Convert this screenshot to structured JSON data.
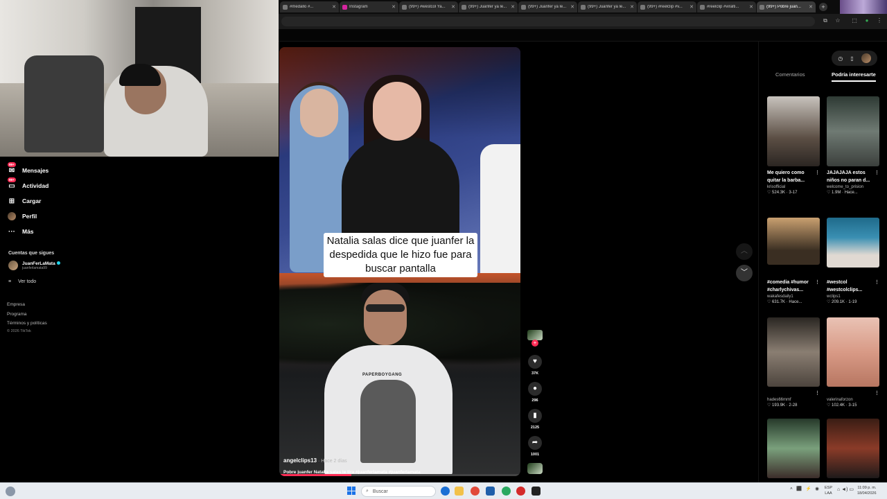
{
  "browser": {
    "tabs": [
      {
        "label": "#medallo #..."
      },
      {
        "label": "Instagram"
      },
      {
        "label": "(99+) #westcol Ya..."
      },
      {
        "label": "(99+) Juanfer ya le..."
      },
      {
        "label": "(99+) Juanfer ya le..."
      },
      {
        "label": "(99+) Juanfer ya le..."
      },
      {
        "label": "(99+) #reelclip #v..."
      },
      {
        "label": "#reelclip #viralti..."
      },
      {
        "label": "(99+) Pobre juan..."
      }
    ],
    "new_tab": "+"
  },
  "leftnav": {
    "items": [
      {
        "label": "Mensajes",
        "badge": "99+"
      },
      {
        "label": "Actividad",
        "badge": "99+"
      },
      {
        "label": "Cargar"
      },
      {
        "label": "Perfil"
      },
      {
        "label": "Más"
      }
    ],
    "following_heading": "Cuentas que sigues",
    "following": {
      "name": "JuanFerLaMata",
      "handle": "juanferlamata99"
    },
    "see_all": "Ver todo",
    "footer": [
      "Empresa",
      "Programa",
      "Términos y políticas",
      "© 2026 TikTok"
    ]
  },
  "video": {
    "caption": "Natalia salas dice que juanfer la despedida que le hizo fue para buscar pantalla",
    "shirt_text": "PAPERBOYGANG",
    "author": "angelclips13",
    "time": " · Hace 2 días",
    "description": "Pobre juanfer Natalia salas le tira #juanferlamata #juanferlamata",
    "progress": 0.3
  },
  "actions": {
    "likes": "37K",
    "comments": "296",
    "saves": "2125",
    "shares": "1001"
  },
  "right_panel": {
    "tabs": {
      "comments": "Comentarios",
      "suggested": "Podría interesarte"
    },
    "cards": [
      {
        "title": "Me quiero como quitar la barba...",
        "user": "krisofficial",
        "stats": "♡ 524.3K · 3-17"
      },
      {
        "title": "JAJAJAJA estos niños no paran d...",
        "user": "welcome_to_prision",
        "stats": "♡ 1.9M · Hace..."
      },
      {
        "title": "#comedia #humor #charlychivas...",
        "user": "wakafesdaily1",
        "stats": "♡ 631.7K · Hace..."
      },
      {
        "title": "#westcol #westcolclips...",
        "user": "wclips1",
        "stats": "♡ 209.1K · 1-19"
      },
      {
        "title": "",
        "user": "hades66mmf",
        "stats": "♡ 193.9K · 2-28"
      },
      {
        "title": "",
        "user": "valerinaforzon",
        "stats": "♡ 102.4K · 3-15"
      },
      {
        "title": "",
        "user": "",
        "stats": ""
      },
      {
        "title": "",
        "user": "",
        "stats": ""
      }
    ]
  },
  "taskbar": {
    "search_placeholder": "Buscar",
    "lang_1": "ESP",
    "lang_2": "LAA",
    "time": "11:09 p. m.",
    "date": "18/04/2026"
  },
  "colors": {
    "accent": "#fe2c55",
    "background": "#000000",
    "verified": "#20d5ec"
  }
}
